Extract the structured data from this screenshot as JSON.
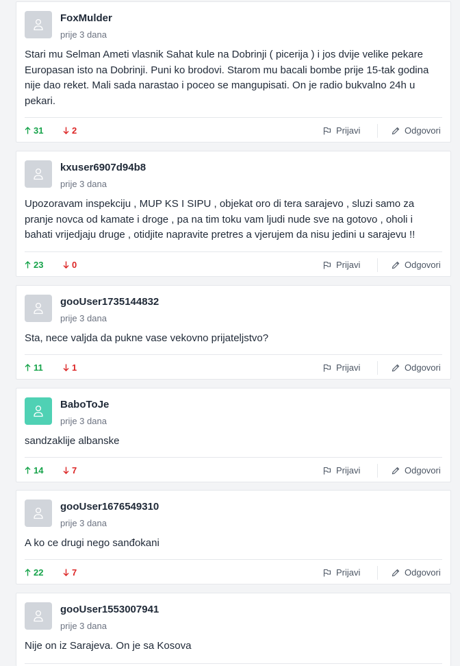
{
  "comments": [
    {
      "username": "FoxMulder",
      "time": "prije 3 dana",
      "text": "Stari mu Selman Ameti vlasnik Sahat kule na Dobrinji ( picerija ) i jos dvije velike pekare Europasan isto na Dobrinji. Puni ko brodovi. Starom mu bacali bombe prije 15-tak godina nije dao reket. Mali sada narastao i poceo se mangupisati. On je radio bukvalno 24h u pekari.",
      "upvotes": "31",
      "downvotes": "2",
      "avatar_color": "#d1d5db"
    },
    {
      "username": "kxuser6907d94b8",
      "time": "prije 3 dana",
      "text": "Upozoravam inspekciju , MUP KS I SIPU , objekat oro di tera sarajevo , sluzi samo za pranje novca od kamate i droge , pa na tim toku vam ljudi nude sve na gotovo , oholi i bahati vrijedjaju druge , otidjite napravite pretres a vjerujem da nisu jedini u sarajevu !!",
      "upvotes": "23",
      "downvotes": "0",
      "avatar_color": "#d1d5db"
    },
    {
      "username": "gooUser1735144832",
      "time": "prije 3 dana",
      "text": "Sta, nece valjda da pukne vase vekovno prijateljstvo?",
      "upvotes": "11",
      "downvotes": "1",
      "avatar_color": "#d1d5db"
    },
    {
      "username": "BaboToJe",
      "time": "prije 3 dana",
      "text": "sandzaklije albanske",
      "upvotes": "14",
      "downvotes": "7",
      "avatar_color": "#4fd1b4"
    },
    {
      "username": "gooUser1676549310",
      "time": "prije 3 dana",
      "text": "A ko ce drugi nego sanđokani",
      "upvotes": "22",
      "downvotes": "7",
      "avatar_color": "#d1d5db"
    },
    {
      "username": "gooUser1553007941",
      "time": "prije 3 dana",
      "text": "Nije on iz Sarajeva. On je sa Kosova",
      "upvotes": "",
      "downvotes": "",
      "avatar_color": "#d1d5db"
    }
  ],
  "actions": {
    "report_label": "Prijavi",
    "reply_label": "Odgovori"
  },
  "colors": {
    "upvote": "#16a34a",
    "downvote": "#dc2626"
  },
  "icons": {
    "avatar": "user-silhouette-icon",
    "upvote": "arrow-up-icon",
    "downvote": "arrow-down-icon",
    "report": "flag-icon",
    "reply": "pencil-icon"
  }
}
